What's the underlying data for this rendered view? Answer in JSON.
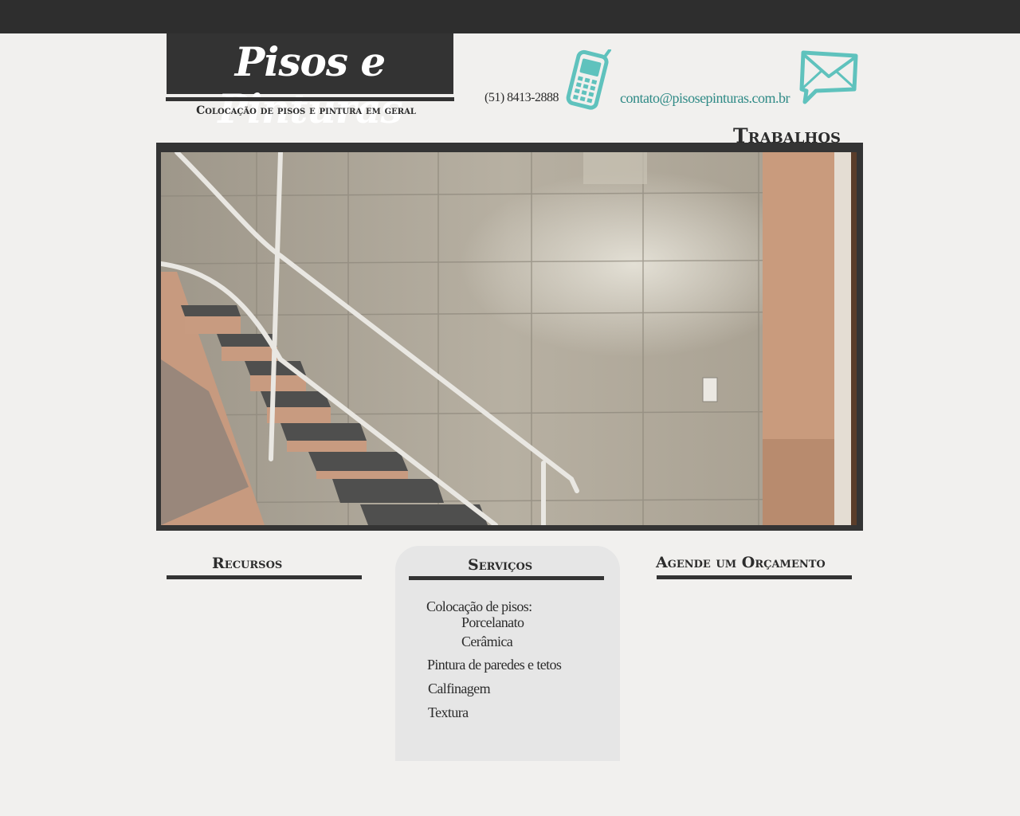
{
  "header": {
    "logo": "Pisos e Pinturas",
    "tagline": "Colocação de pisos e pintura em geral",
    "phone": "(51) 8413-2888",
    "phone_icon": "phone-icon",
    "email": "contato@pisosepinturas.com.br",
    "email_icon": "mail-icon"
  },
  "gallery": {
    "title": "Trabalhos",
    "image": "staircase-photo"
  },
  "columns": {
    "recursos": {
      "title": "Recursos"
    },
    "servicos": {
      "title": "Serviços",
      "items": [
        "Colocação de pisos:",
        "Porcelanato",
        "Cerâmica",
        "Pintura de paredes e tetos",
        "Calfinagem",
        "Textura"
      ]
    },
    "orcamento": {
      "title": "Agende um Orçamento"
    }
  },
  "colors": {
    "background": "#f1f0ee",
    "dark": "#333333",
    "accent": "#2f8a86",
    "icon": "#5fc2bd",
    "panel": "#e6e6e6"
  }
}
